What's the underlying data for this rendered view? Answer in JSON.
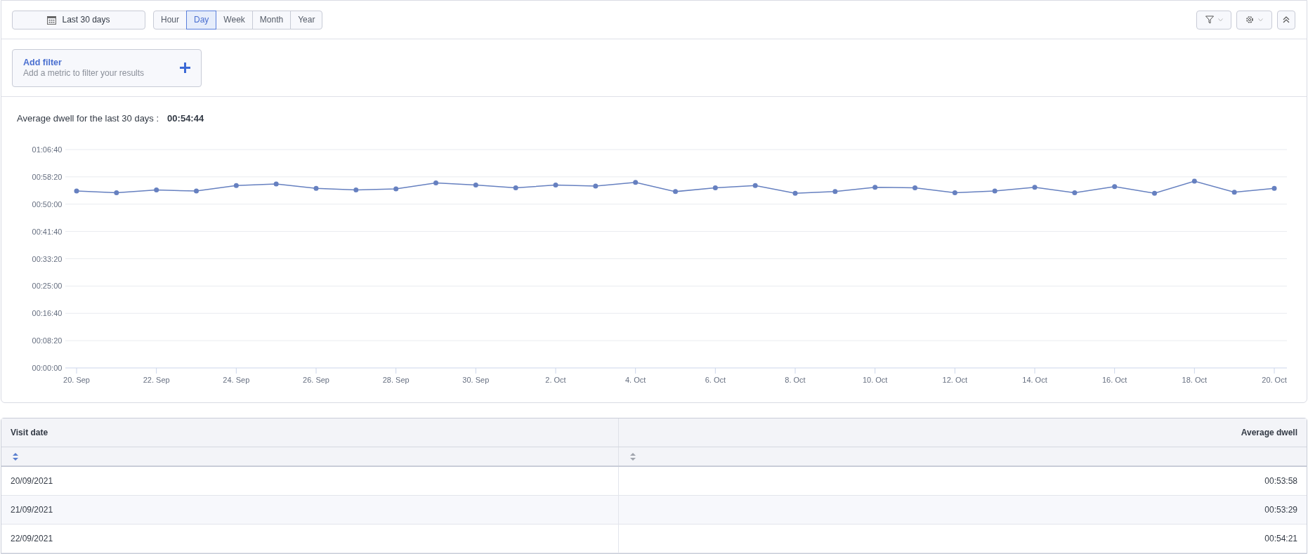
{
  "toolbar": {
    "date_range": "Last 30 days",
    "granularity": [
      {
        "label": "Hour",
        "selected": false
      },
      {
        "label": "Day",
        "selected": true
      },
      {
        "label": "Week",
        "selected": false
      },
      {
        "label": "Month",
        "selected": false
      },
      {
        "label": "Year",
        "selected": false
      }
    ]
  },
  "filter": {
    "title": "Add filter",
    "subtitle": "Add a metric to filter your results"
  },
  "summary": {
    "label": "Average dwell for the last 30 days :",
    "value": "00:54:44"
  },
  "chart_data": {
    "type": "line",
    "grid": true,
    "categories": [
      "20. Sep",
      null,
      "22. Sep",
      null,
      "24. Sep",
      null,
      "26. Sep",
      null,
      "28. Sep",
      null,
      "30. Sep",
      null,
      "2. Oct",
      null,
      "4. Oct",
      null,
      "6. Oct",
      null,
      "8. Oct",
      null,
      "10. Oct",
      null,
      "12. Oct",
      null,
      "14. Oct",
      null,
      "16. Oct",
      null,
      "18. Oct",
      null,
      "20. Oct"
    ],
    "series": [
      {
        "color": "#6680c0",
        "marker": "circle",
        "values": [
          3240,
          3210,
          3260,
          3240,
          3340,
          3370,
          3290,
          3260,
          3280,
          3390,
          3350,
          3300,
          3350,
          3330,
          3400,
          3230,
          3300,
          3340,
          3200,
          3230,
          3310,
          3300,
          3210,
          3240,
          3310,
          3210,
          3320,
          3200,
          3420,
          3220,
          3290
        ]
      }
    ],
    "ylim": [
      0,
      4000
    ],
    "yticks": [
      {
        "value": 0,
        "label": "00:00:00"
      },
      {
        "value": 500,
        "label": "00:08:20"
      },
      {
        "value": 1000,
        "label": "00:16:40"
      },
      {
        "value": 1500,
        "label": "00:25:00"
      },
      {
        "value": 2000,
        "label": "00:33:20"
      },
      {
        "value": 2500,
        "label": "00:41:40"
      },
      {
        "value": 3000,
        "label": "00:50:00"
      },
      {
        "value": 3500,
        "label": "00:58:20"
      },
      {
        "value": 4000,
        "label": "01:06:40"
      }
    ]
  },
  "table": {
    "columns": [
      {
        "label": "Visit date",
        "sort_active": true
      },
      {
        "label": "Average dwell",
        "sort_active": false
      }
    ],
    "rows": [
      [
        "20/09/2021",
        "00:53:58"
      ],
      [
        "21/09/2021",
        "00:53:29"
      ],
      [
        "22/09/2021",
        "00:54:21"
      ]
    ]
  }
}
